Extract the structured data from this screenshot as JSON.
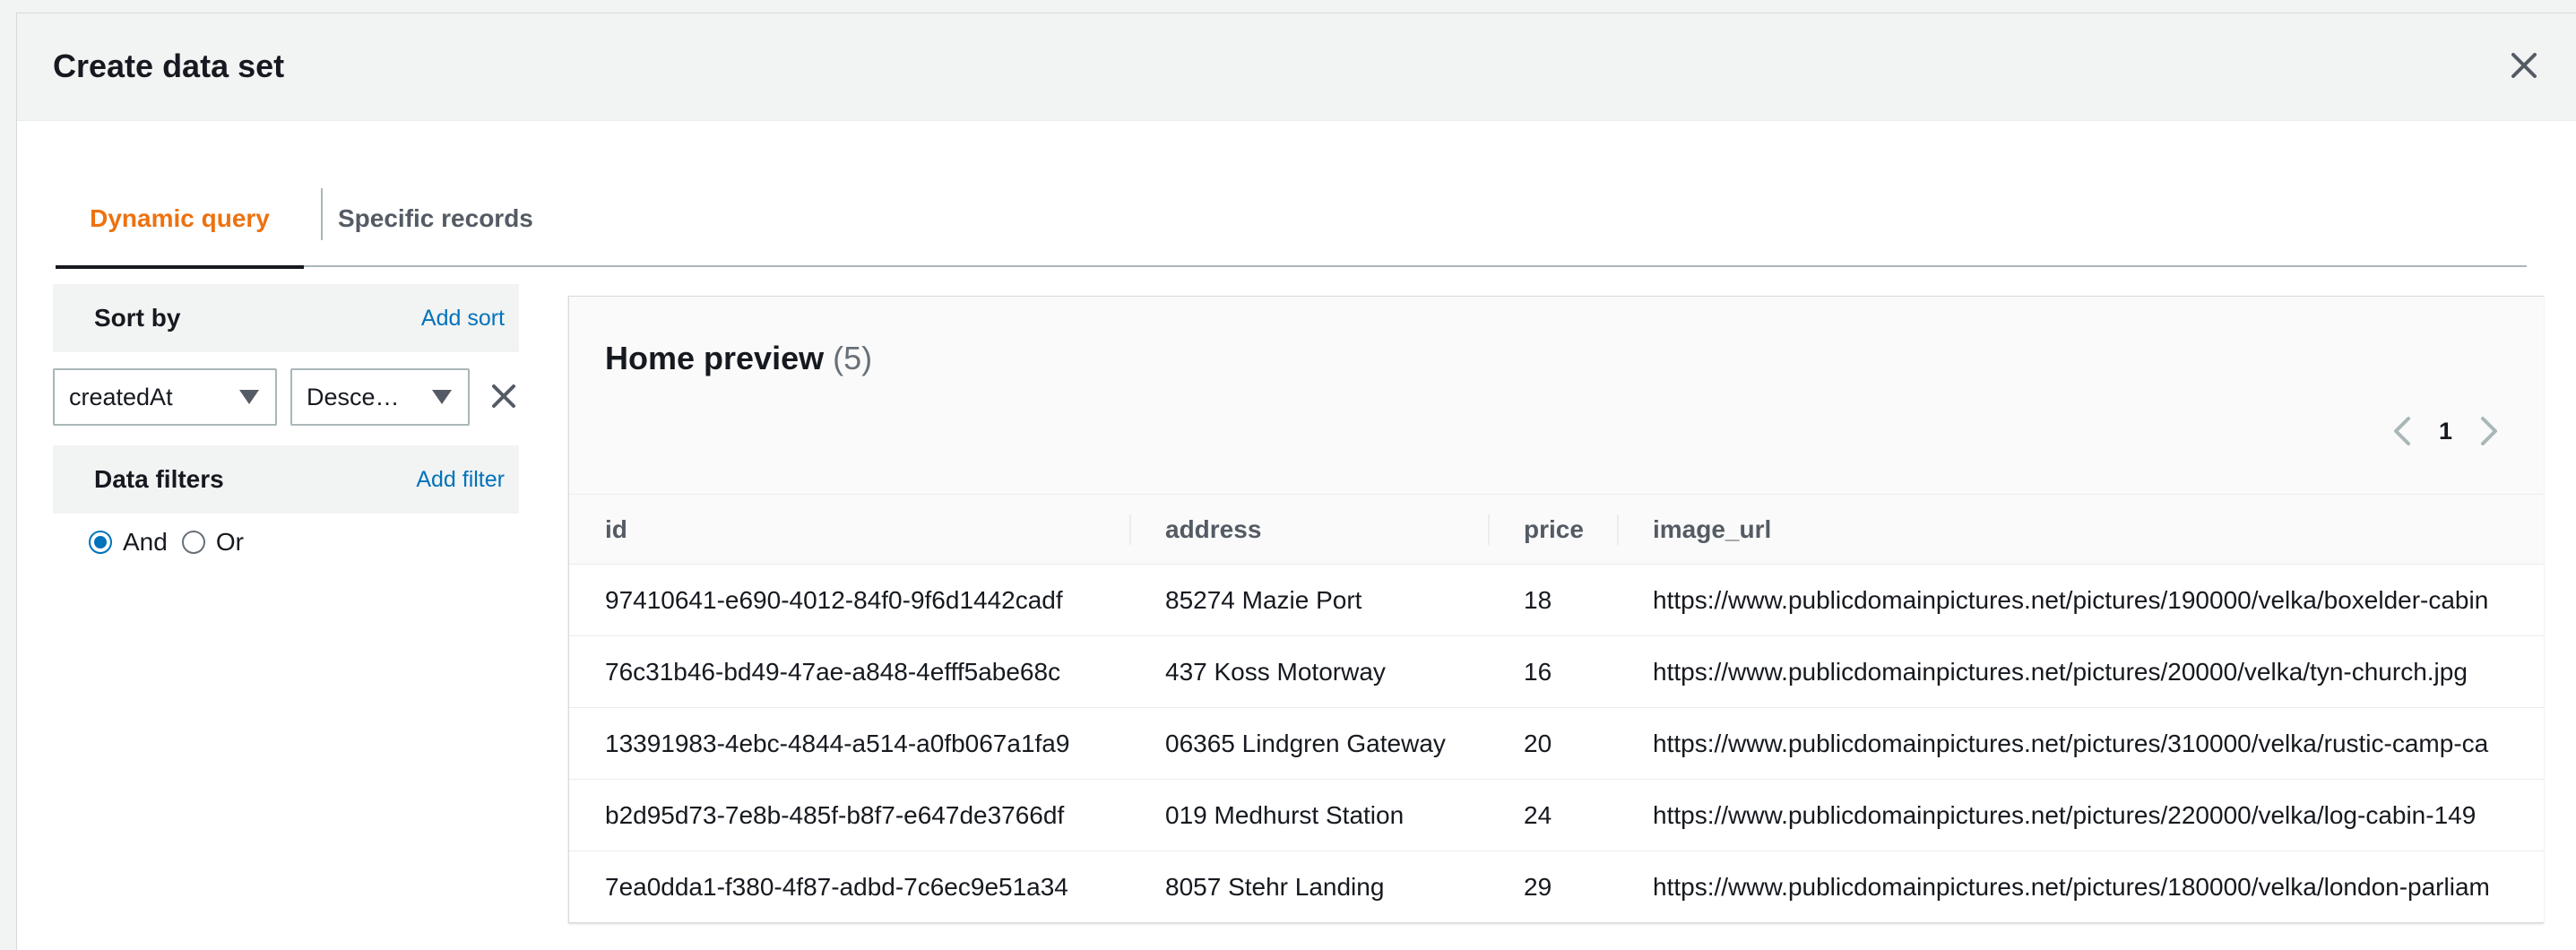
{
  "modal": {
    "title": "Create data set"
  },
  "tabs": [
    {
      "label": "Dynamic query",
      "active": true
    },
    {
      "label": "Specific records",
      "active": false
    }
  ],
  "sort": {
    "heading": "Sort by",
    "add_label": "Add sort",
    "field_value": "createdAt",
    "direction_value": "Desce…"
  },
  "filters": {
    "heading": "Data filters",
    "add_label": "Add filter",
    "options": [
      "And",
      "Or"
    ],
    "selected": "And"
  },
  "preview": {
    "title": "Home preview",
    "count": "(5)",
    "page": "1",
    "columns": [
      "id",
      "address",
      "price",
      "image_url"
    ],
    "rows": [
      [
        "97410641-e690-4012-84f0-9f6d1442cadf",
        "85274 Mazie Port",
        "18",
        "https://www.publicdomainpictures.net/pictures/190000/velka/boxelder-cabin"
      ],
      [
        "76c31b46-bd49-47ae-a848-4efff5abe68c",
        "437 Koss Motorway",
        "16",
        "https://www.publicdomainpictures.net/pictures/20000/velka/tyn-church.jpg"
      ],
      [
        "13391983-4ebc-4844-a514-a0fb067a1fa9",
        "06365 Lindgren Gateway",
        "20",
        "https://www.publicdomainpictures.net/pictures/310000/velka/rustic-camp-ca"
      ],
      [
        "b2d95d73-7e8b-485f-b8f7-e647de3766df",
        "019 Medhurst Station",
        "24",
        "https://www.publicdomainpictures.net/pictures/220000/velka/log-cabin-149"
      ],
      [
        "7ea0dda1-f380-4f87-adbd-7c6ec9e51a34",
        "8057 Stehr Landing",
        "29",
        "https://www.publicdomainpictures.net/pictures/180000/velka/london-parliam"
      ]
    ]
  },
  "colors": {
    "accent": "#ec7211",
    "link": "#0073bb"
  },
  "icons": {
    "close": "close-icon",
    "caret": "caret-down-icon",
    "prev": "chevron-left-icon",
    "next": "chevron-right-icon"
  }
}
